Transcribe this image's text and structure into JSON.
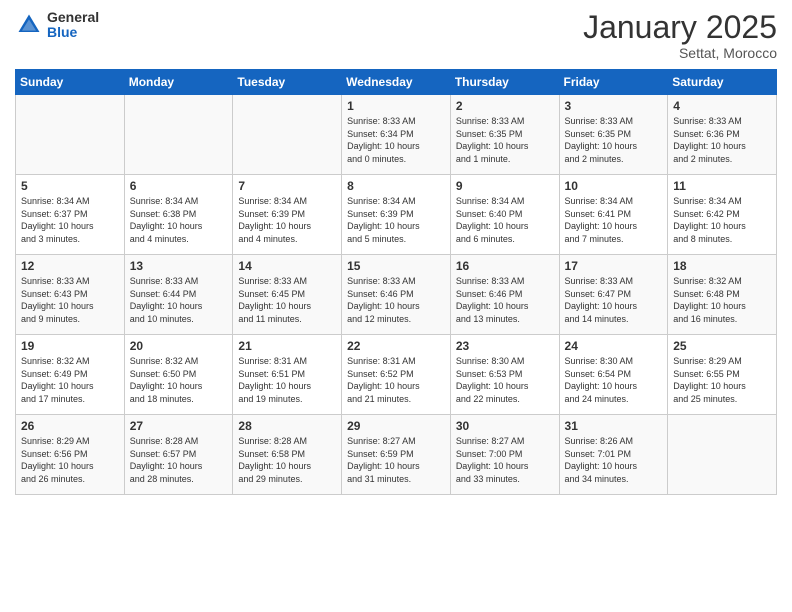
{
  "header": {
    "logo_general": "General",
    "logo_blue": "Blue",
    "month": "January 2025",
    "location": "Settat, Morocco"
  },
  "days_of_week": [
    "Sunday",
    "Monday",
    "Tuesday",
    "Wednesday",
    "Thursday",
    "Friday",
    "Saturday"
  ],
  "weeks": [
    [
      {
        "day": "",
        "info": ""
      },
      {
        "day": "",
        "info": ""
      },
      {
        "day": "",
        "info": ""
      },
      {
        "day": "1",
        "info": "Sunrise: 8:33 AM\nSunset: 6:34 PM\nDaylight: 10 hours\nand 0 minutes."
      },
      {
        "day": "2",
        "info": "Sunrise: 8:33 AM\nSunset: 6:35 PM\nDaylight: 10 hours\nand 1 minute."
      },
      {
        "day": "3",
        "info": "Sunrise: 8:33 AM\nSunset: 6:35 PM\nDaylight: 10 hours\nand 2 minutes."
      },
      {
        "day": "4",
        "info": "Sunrise: 8:33 AM\nSunset: 6:36 PM\nDaylight: 10 hours\nand 2 minutes."
      }
    ],
    [
      {
        "day": "5",
        "info": "Sunrise: 8:34 AM\nSunset: 6:37 PM\nDaylight: 10 hours\nand 3 minutes."
      },
      {
        "day": "6",
        "info": "Sunrise: 8:34 AM\nSunset: 6:38 PM\nDaylight: 10 hours\nand 4 minutes."
      },
      {
        "day": "7",
        "info": "Sunrise: 8:34 AM\nSunset: 6:39 PM\nDaylight: 10 hours\nand 4 minutes."
      },
      {
        "day": "8",
        "info": "Sunrise: 8:34 AM\nSunset: 6:39 PM\nDaylight: 10 hours\nand 5 minutes."
      },
      {
        "day": "9",
        "info": "Sunrise: 8:34 AM\nSunset: 6:40 PM\nDaylight: 10 hours\nand 6 minutes."
      },
      {
        "day": "10",
        "info": "Sunrise: 8:34 AM\nSunset: 6:41 PM\nDaylight: 10 hours\nand 7 minutes."
      },
      {
        "day": "11",
        "info": "Sunrise: 8:34 AM\nSunset: 6:42 PM\nDaylight: 10 hours\nand 8 minutes."
      }
    ],
    [
      {
        "day": "12",
        "info": "Sunrise: 8:33 AM\nSunset: 6:43 PM\nDaylight: 10 hours\nand 9 minutes."
      },
      {
        "day": "13",
        "info": "Sunrise: 8:33 AM\nSunset: 6:44 PM\nDaylight: 10 hours\nand 10 minutes."
      },
      {
        "day": "14",
        "info": "Sunrise: 8:33 AM\nSunset: 6:45 PM\nDaylight: 10 hours\nand 11 minutes."
      },
      {
        "day": "15",
        "info": "Sunrise: 8:33 AM\nSunset: 6:46 PM\nDaylight: 10 hours\nand 12 minutes."
      },
      {
        "day": "16",
        "info": "Sunrise: 8:33 AM\nSunset: 6:46 PM\nDaylight: 10 hours\nand 13 minutes."
      },
      {
        "day": "17",
        "info": "Sunrise: 8:33 AM\nSunset: 6:47 PM\nDaylight: 10 hours\nand 14 minutes."
      },
      {
        "day": "18",
        "info": "Sunrise: 8:32 AM\nSunset: 6:48 PM\nDaylight: 10 hours\nand 16 minutes."
      }
    ],
    [
      {
        "day": "19",
        "info": "Sunrise: 8:32 AM\nSunset: 6:49 PM\nDaylight: 10 hours\nand 17 minutes."
      },
      {
        "day": "20",
        "info": "Sunrise: 8:32 AM\nSunset: 6:50 PM\nDaylight: 10 hours\nand 18 minutes."
      },
      {
        "day": "21",
        "info": "Sunrise: 8:31 AM\nSunset: 6:51 PM\nDaylight: 10 hours\nand 19 minutes."
      },
      {
        "day": "22",
        "info": "Sunrise: 8:31 AM\nSunset: 6:52 PM\nDaylight: 10 hours\nand 21 minutes."
      },
      {
        "day": "23",
        "info": "Sunrise: 8:30 AM\nSunset: 6:53 PM\nDaylight: 10 hours\nand 22 minutes."
      },
      {
        "day": "24",
        "info": "Sunrise: 8:30 AM\nSunset: 6:54 PM\nDaylight: 10 hours\nand 24 minutes."
      },
      {
        "day": "25",
        "info": "Sunrise: 8:29 AM\nSunset: 6:55 PM\nDaylight: 10 hours\nand 25 minutes."
      }
    ],
    [
      {
        "day": "26",
        "info": "Sunrise: 8:29 AM\nSunset: 6:56 PM\nDaylight: 10 hours\nand 26 minutes."
      },
      {
        "day": "27",
        "info": "Sunrise: 8:28 AM\nSunset: 6:57 PM\nDaylight: 10 hours\nand 28 minutes."
      },
      {
        "day": "28",
        "info": "Sunrise: 8:28 AM\nSunset: 6:58 PM\nDaylight: 10 hours\nand 29 minutes."
      },
      {
        "day": "29",
        "info": "Sunrise: 8:27 AM\nSunset: 6:59 PM\nDaylight: 10 hours\nand 31 minutes."
      },
      {
        "day": "30",
        "info": "Sunrise: 8:27 AM\nSunset: 7:00 PM\nDaylight: 10 hours\nand 33 minutes."
      },
      {
        "day": "31",
        "info": "Sunrise: 8:26 AM\nSunset: 7:01 PM\nDaylight: 10 hours\nand 34 minutes."
      },
      {
        "day": "",
        "info": ""
      }
    ]
  ]
}
